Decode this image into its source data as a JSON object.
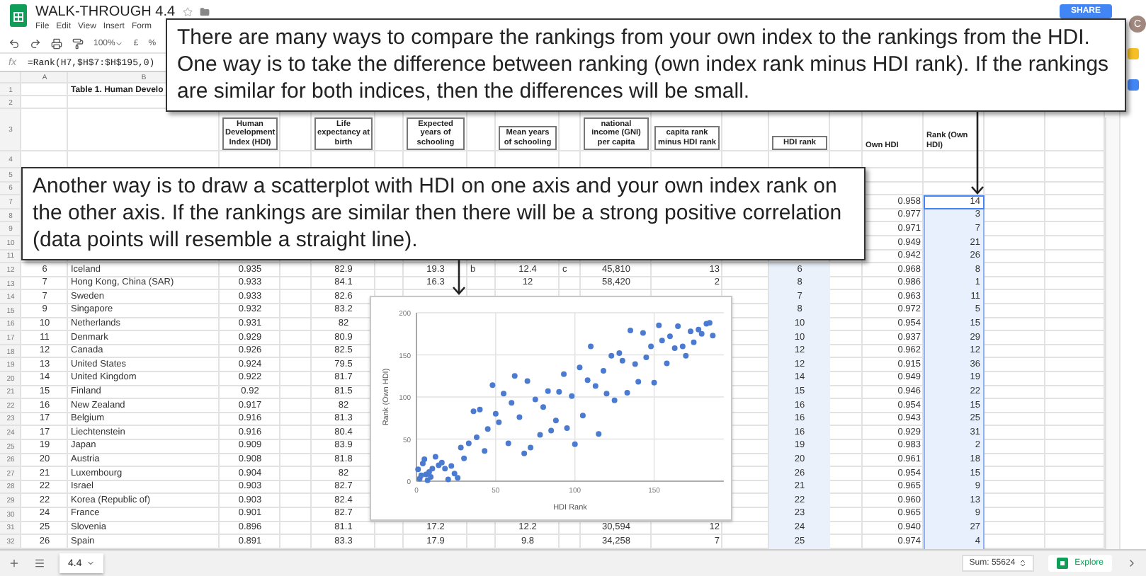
{
  "document": {
    "title": "WALK-THROUGH 4.4"
  },
  "menu": [
    "File",
    "Edit",
    "View",
    "Insert",
    "Form"
  ],
  "share_button": "SHARE",
  "account": "C",
  "toolbar": {
    "zoom": "100%",
    "currency": "£",
    "percent": "%"
  },
  "formula_bar": {
    "label": "fx",
    "formula": "=Rank(H7,$H$7:$H$195,0)"
  },
  "column_headers": [
    "A",
    "B"
  ],
  "sheet": {
    "rows": [
      {
        "number": "1",
        "kind": "title",
        "title": "Table 1. Human Develo"
      },
      {
        "number": "2",
        "kind": "data"
      },
      {
        "number": "3",
        "kind": "header",
        "cells": {
          "hdi": "Human Development Index (HDI)",
          "life": "Life expectancy at birth",
          "expected": "Expected years of schooling",
          "mean": "Mean years of schooling",
          "gni": "national income (GNI) per capita",
          "gni_rank_diff": "capita rank minus HDI rank",
          "rank": "HDI rank",
          "own_hdi": "Own HDI",
          "own_rank": "Rank (Own HDI)"
        }
      },
      {
        "number": "4",
        "kind": "data"
      },
      {
        "number": "5",
        "kind": "data"
      },
      {
        "number": "6",
        "kind": "data"
      },
      {
        "number": "7",
        "kind": "data",
        "cells": {
          "own_hdi": "0.958",
          "own_rank": "14"
        },
        "selected": true,
        "active": true
      },
      {
        "number": "8",
        "kind": "data",
        "cells": {
          "own_hdi": "0.977",
          "own_rank": "3"
        },
        "selected": true,
        "active": false
      },
      {
        "number": "9",
        "kind": "data",
        "cells": {
          "own_hdi": "0.971",
          "own_rank": "7"
        },
        "selected": true,
        "active": false
      },
      {
        "number": "10",
        "kind": "data",
        "cells": {
          "own_hdi": "0.949",
          "own_rank": "21"
        },
        "selected": true,
        "active": false
      },
      {
        "number": "11",
        "kind": "data",
        "cells": {
          "own_hdi": "0.942",
          "own_rank": "26"
        },
        "selected": true,
        "active": false
      },
      {
        "number": "12",
        "kind": "data",
        "cells": {
          "hdi_rank": "6",
          "country": "Iceland",
          "hdi": "0.935",
          "life": "82.9",
          "expected": "19.3",
          "expected_note": "b",
          "mean": "12.4",
          "mean_note": "c",
          "gni": "45,810",
          "gni_rank_diff": "13",
          "rank": "6",
          "own_hdi": "0.968",
          "own_rank": "8"
        },
        "selected": true,
        "active": false
      },
      {
        "number": "13",
        "kind": "data",
        "cells": {
          "hdi_rank": "7",
          "country": "Hong Kong, China (SAR)",
          "hdi": "0.933",
          "life": "84.1",
          "expected": "16.3",
          "mean": "12",
          "gni": "58,420",
          "gni_rank_diff": "2",
          "rank": "8",
          "own_hdi": "0.986",
          "own_rank": "1"
        },
        "selected": true,
        "active": false
      },
      {
        "number": "14",
        "kind": "data",
        "cells": {
          "hdi_rank": "7",
          "country": "Sweden",
          "hdi": "0.933",
          "life": "82.6",
          "rank": "7",
          "own_hdi": "0.963",
          "own_rank": "11"
        },
        "selected": true,
        "active": false
      },
      {
        "number": "15",
        "kind": "data",
        "cells": {
          "hdi_rank": "9",
          "country": "Singapore",
          "hdi": "0.932",
          "life": "83.2",
          "rank": "8",
          "own_hdi": "0.972",
          "own_rank": "5"
        },
        "selected": true,
        "active": false
      },
      {
        "number": "16",
        "kind": "data",
        "cells": {
          "hdi_rank": "10",
          "country": "Netherlands",
          "hdi": "0.931",
          "life": "82",
          "rank": "10",
          "own_hdi": "0.954",
          "own_rank": "15"
        },
        "selected": true,
        "active": false
      },
      {
        "number": "17",
        "kind": "data",
        "cells": {
          "hdi_rank": "11",
          "country": "Denmark",
          "hdi": "0.929",
          "life": "80.9",
          "rank": "10",
          "own_hdi": "0.937",
          "own_rank": "29"
        },
        "selected": true,
        "active": false
      },
      {
        "number": "18",
        "kind": "data",
        "cells": {
          "hdi_rank": "12",
          "country": "Canada",
          "hdi": "0.926",
          "life": "82.5",
          "rank": "12",
          "own_hdi": "0.962",
          "own_rank": "12"
        },
        "selected": true,
        "active": false
      },
      {
        "number": "19",
        "kind": "data",
        "cells": {
          "hdi_rank": "13",
          "country": "United States",
          "hdi": "0.924",
          "life": "79.5",
          "rank": "12",
          "own_hdi": "0.915",
          "own_rank": "36"
        },
        "selected": true,
        "active": false
      },
      {
        "number": "20",
        "kind": "data",
        "cells": {
          "hdi_rank": "14",
          "country": "United Kingdom",
          "hdi": "0.922",
          "life": "81.7",
          "rank": "14",
          "own_hdi": "0.949",
          "own_rank": "19"
        },
        "selected": true,
        "active": false
      },
      {
        "number": "21",
        "kind": "data",
        "cells": {
          "hdi_rank": "15",
          "country": "Finland",
          "hdi": "0.92",
          "life": "81.5",
          "rank": "15",
          "own_hdi": "0.946",
          "own_rank": "22"
        },
        "selected": true,
        "active": false
      },
      {
        "number": "22",
        "kind": "data",
        "cells": {
          "hdi_rank": "16",
          "country": "New Zealand",
          "hdi": "0.917",
          "life": "82",
          "rank": "16",
          "own_hdi": "0.954",
          "own_rank": "15"
        },
        "selected": true,
        "active": false
      },
      {
        "number": "23",
        "kind": "data",
        "cells": {
          "hdi_rank": "17",
          "country": "Belgium",
          "hdi": "0.916",
          "life": "81.3",
          "rank": "16",
          "own_hdi": "0.943",
          "own_rank": "25"
        },
        "selected": true,
        "active": false
      },
      {
        "number": "24",
        "kind": "data",
        "cells": {
          "hdi_rank": "17",
          "country": "Liechtenstein",
          "hdi": "0.916",
          "life": "80.4",
          "rank": "16",
          "own_hdi": "0.929",
          "own_rank": "31"
        },
        "selected": true,
        "active": false
      },
      {
        "number": "25",
        "kind": "data",
        "cells": {
          "hdi_rank": "19",
          "country": "Japan",
          "hdi": "0.909",
          "life": "83.9",
          "rank": "19",
          "own_hdi": "0.983",
          "own_rank": "2"
        },
        "selected": true,
        "active": false
      },
      {
        "number": "26",
        "kind": "data",
        "cells": {
          "hdi_rank": "20",
          "country": "Austria",
          "hdi": "0.908",
          "life": "81.8",
          "rank": "20",
          "own_hdi": "0.961",
          "own_rank": "18"
        },
        "selected": true,
        "active": false
      },
      {
        "number": "27",
        "kind": "data",
        "cells": {
          "hdi_rank": "21",
          "country": "Luxembourg",
          "hdi": "0.904",
          "life": "82",
          "rank": "26",
          "own_hdi": "0.954",
          "own_rank": "15"
        },
        "selected": true,
        "active": false
      },
      {
        "number": "28",
        "kind": "data",
        "cells": {
          "hdi_rank": "22",
          "country": "Israel",
          "hdi": "0.903",
          "life": "82.7",
          "rank": "21",
          "own_hdi": "0.965",
          "own_rank": "9"
        },
        "selected": true,
        "active": false
      },
      {
        "number": "29",
        "kind": "data",
        "cells": {
          "hdi_rank": "22",
          "country": "Korea (Republic of)",
          "hdi": "0.903",
          "life": "82.4",
          "rank": "22",
          "own_hdi": "0.960",
          "own_rank": "13"
        },
        "selected": true,
        "active": false
      },
      {
        "number": "30",
        "kind": "data",
        "cells": {
          "hdi_rank": "24",
          "country": "France",
          "hdi": "0.901",
          "life": "82.7",
          "rank": "23",
          "own_hdi": "0.965",
          "own_rank": "9"
        },
        "selected": true,
        "active": false
      },
      {
        "number": "31",
        "kind": "data",
        "cells": {
          "hdi_rank": "25",
          "country": "Slovenia",
          "hdi": "0.896",
          "life": "81.1",
          "expected": "17.2",
          "mean": "12.2",
          "gni": "30,594",
          "gni_rank_diff": "12",
          "rank": "24",
          "own_hdi": "0.940",
          "own_rank": "27"
        },
        "selected": true,
        "active": false
      },
      {
        "number": "32",
        "kind": "data",
        "cells": {
          "hdi_rank": "26",
          "country": "Spain",
          "hdi": "0.891",
          "life": "83.3",
          "expected": "17.9",
          "mean": "9.8",
          "gni": "34,258",
          "gni_rank_diff": "7",
          "rank": "25",
          "own_hdi": "0.974",
          "own_rank": "4"
        },
        "selected": true,
        "active": false
      }
    ]
  },
  "callouts": [
    {
      "text": "There are many ways to compare the rankings from your own index to the rankings from the HDI. One way is to take the difference between ranking (own index rank minus HDI rank). If the rankings are similar for both indices, then the differences will be small."
    },
    {
      "text": "Another way is to draw a scatterplot with HDI on one axis and your own index rank on the other axis. If the rankings are similar then there will be a strong positive correlation (data points will resemble a straight line)."
    }
  ],
  "chart": {
    "chart_data": {
      "type": "scatter",
      "grid": true,
      "xlabel": "HDI Rank",
      "ylabel": "Rank (Own HDI)",
      "xlim": [
        0,
        194
      ],
      "ylim": [
        0,
        200
      ],
      "xticks": [
        0,
        50,
        100,
        150
      ],
      "yticks": [
        0,
        50,
        100,
        150,
        200
      ],
      "x": [
        1,
        2,
        3,
        4,
        5,
        6,
        7,
        8,
        9,
        10,
        12,
        14,
        16,
        18,
        20,
        22,
        24,
        26,
        28,
        30,
        33,
        36,
        38,
        40,
        43,
        45,
        48,
        50,
        52,
        55,
        58,
        60,
        62,
        65,
        68,
        70,
        72,
        75,
        78,
        80,
        83,
        85,
        88,
        90,
        93,
        95,
        98,
        100,
        103,
        105,
        108,
        110,
        113,
        115,
        118,
        120,
        123,
        125,
        128,
        130,
        133,
        135,
        138,
        140,
        143,
        145,
        148,
        150,
        153,
        155,
        158,
        160,
        163,
        165,
        168,
        170,
        173,
        175,
        178,
        180,
        183,
        185,
        187
      ],
      "series": [
        {
          "color": "#4a7bd0",
          "values": [
            14,
            3,
            7,
            21,
            26,
            8,
            1,
            11,
            5,
            15,
            29,
            19,
            22,
            15,
            2,
            18,
            9,
            4,
            40,
            27,
            45,
            83,
            52,
            85,
            36,
            62,
            114,
            80,
            70,
            104,
            45,
            93,
            125,
            76,
            33,
            119,
            40,
            97,
            55,
            88,
            107,
            60,
            72,
            106,
            127,
            63,
            101,
            44,
            135,
            78,
            120,
            160,
            113,
            56,
            131,
            104,
            149,
            96,
            152,
            143,
            105,
            179,
            139,
            118,
            176,
            147,
            160,
            117,
            185,
            167,
            140,
            172,
            158,
            184,
            160,
            149,
            178,
            165,
            180,
            175,
            187,
            188,
            173
          ]
        }
      ]
    }
  },
  "sheet_tabs": [
    {
      "label": "4.4",
      "selected": true
    }
  ],
  "status_bar": {
    "sum": "Sum: 55624",
    "explore": "Explore"
  }
}
